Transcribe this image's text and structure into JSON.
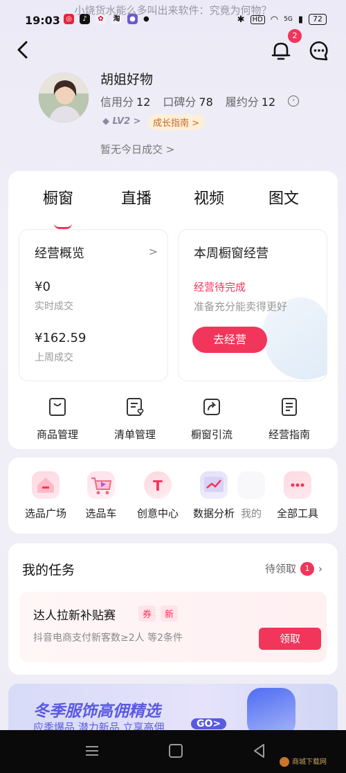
{
  "watermark": "小烧货水能么多叫出来软件：究竟为何物？",
  "status_bar": {
    "time": "19:03",
    "network": "5G",
    "battery": "72"
  },
  "header": {
    "notification_count": "2"
  },
  "profile": {
    "name": "胡姐好物",
    "stats": [
      {
        "label": "信用分",
        "value": "12"
      },
      {
        "label": "口碑分",
        "value": "78"
      },
      {
        "label": "履约分",
        "value": "12"
      }
    ],
    "level": "LV2",
    "level_arrow": ">",
    "growth_guide": "成长指南 >",
    "today_deal": "暂无今日成交 >"
  },
  "tabs": [
    "橱窗",
    "直播",
    "视频",
    "图文"
  ],
  "overview": {
    "title": "经营概览",
    "arrow": ">",
    "realtime_value": "¥0",
    "realtime_label": "实时成交",
    "lastweek_value": "¥162.59",
    "lastweek_label": "上周成交"
  },
  "weekly": {
    "title": "本周橱窗经营",
    "status": "经营待完成",
    "hint": "准备充分能卖得更好",
    "button": "去经营"
  },
  "tools": [
    "商品管理",
    "清单管理",
    "橱窗引流",
    "经营指南"
  ],
  "quick_tools": [
    "选品广场",
    "选品车",
    "创意中心",
    "数据分析",
    "我的",
    "全部工具"
  ],
  "tasks": {
    "title": "我的任务",
    "pending_label": "待领取",
    "pending_count": "1",
    "item_name": "达人拉新补贴赛",
    "tag1": "券",
    "tag2": "新",
    "item_desc": "抖音电商支付新客数≥2人  等2条件",
    "claim_button": "领取"
  },
  "banner": {
    "title": "冬季服饰高佣精选",
    "subtitle": "应季爆品  潜力新品  立享高佣",
    "go": "GO>"
  },
  "brand": "商城下载网",
  "colors": {
    "accent": "#f2355a",
    "banner_blue": "#5a5ae0"
  }
}
